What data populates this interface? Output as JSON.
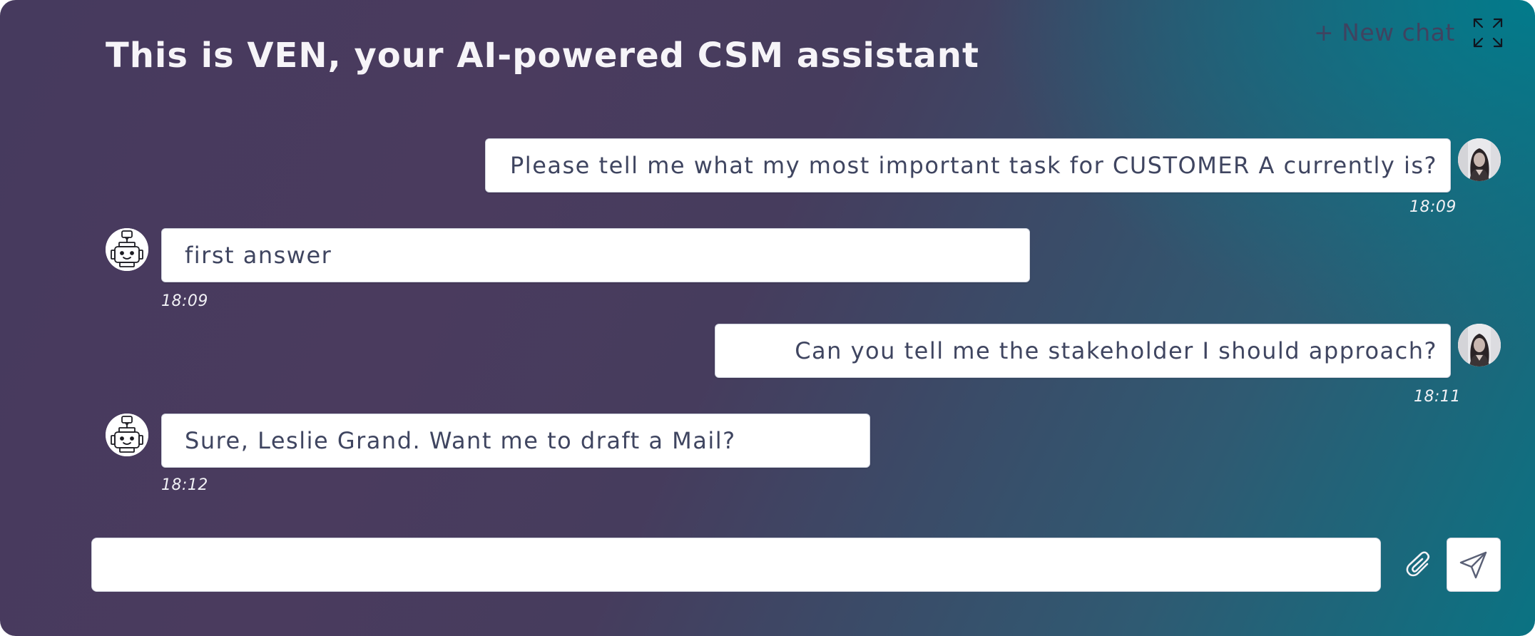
{
  "header": {
    "title": "This is VEN, your AI-powered CSM assistant",
    "new_chat_label": "+ New chat",
    "expand_icon": "expand-arrows-icon"
  },
  "messages": [
    {
      "role": "user",
      "text": "Please tell me what my most important task for CUSTOMER A currently is?",
      "time": "18:09"
    },
    {
      "role": "bot",
      "text": "first answer",
      "time": "18:09"
    },
    {
      "role": "user",
      "text": "Can you tell me the stakeholder I should approach?",
      "time": "18:11"
    },
    {
      "role": "bot",
      "text": "Sure, Leslie Grand. Want me to draft a Mail?",
      "time": "18:12"
    }
  ],
  "composer": {
    "input_value": "",
    "input_placeholder": "",
    "attach_icon": "paperclip-icon",
    "send_icon": "send-icon"
  },
  "colors": {
    "gradient_start": "#463a5e",
    "gradient_end": "#0a7383",
    "bubble_bg": "#ffffff",
    "bubble_text": "#3f4560"
  }
}
